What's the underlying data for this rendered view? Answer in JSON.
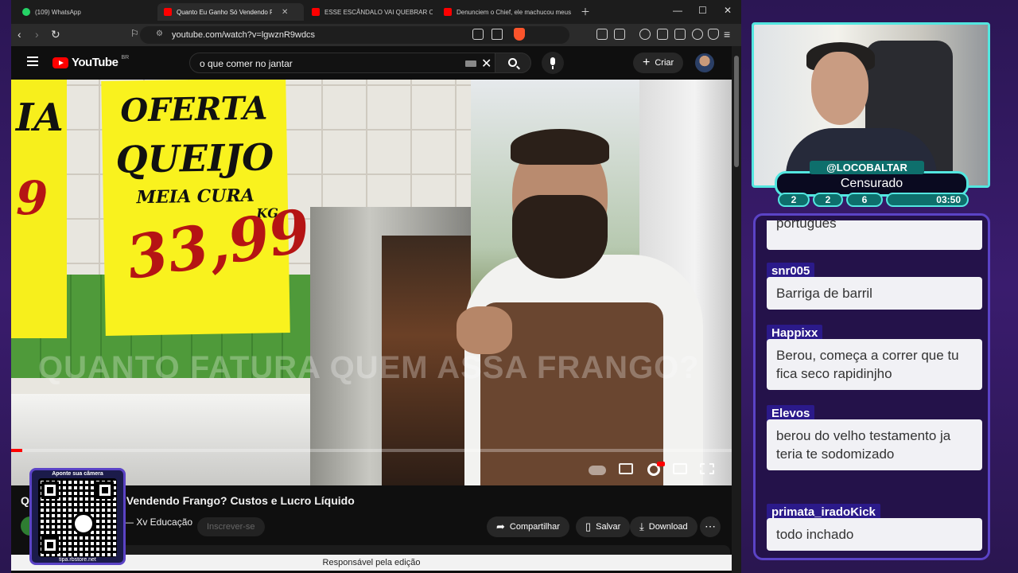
{
  "browser": {
    "tabs": [
      {
        "label": "(109) WhatsApp",
        "icon": "whatsapp-icon"
      },
      {
        "label": "Quanto Eu Ganho Só Vendendo Fra",
        "icon": "youtube-icon",
        "active": true
      },
      {
        "label": "ESSE ESCÂNDALO VAI QUEBRAR O BRASIL E",
        "icon": "youtube-icon"
      },
      {
        "label": "Denunciem o Chief, ele machucou meus sen",
        "icon": "youtube-icon"
      }
    ],
    "url": "youtube.com/watch?v=lgwznR9wdcs"
  },
  "youtube": {
    "logo_text": "YouTube",
    "region": "BR",
    "search_query": "o que comer no jantar",
    "create_label": "Criar",
    "video_overlay_text": "QUANTO FATURA QUEM ASSA FRANGO?",
    "sign_words": {
      "oferta": "OFERTA",
      "queijo": "QUEIJO",
      "meia_cura": "MEIA CURA",
      "kg": "KG",
      "price": "33,99",
      "left_letters": "IA"
    },
    "progress_fraction": 0.016,
    "video_title": "Q... Vendendo Frango? Custos e Lucro Líquido",
    "video_title_visible": "Q",
    "video_title_rest": "Vendendo Frango? Custos e Lucro Líquido",
    "channel": "Xv Educação",
    "subscribe_label": "Inscrever-se",
    "share_label": "Compartilhar",
    "save_label": "Salvar",
    "download_label": "Download",
    "responsavel": "Responsável pela edição"
  },
  "qr": {
    "top": "Aponte sua câmera",
    "bottom": "tipa.rbstore.net"
  },
  "stream": {
    "handle": "@LOCOBALTAR",
    "label": "Censurado",
    "stats": [
      "2",
      "2",
      "6",
      "03:50"
    ]
  },
  "chat": {
    "partial": "português",
    "messages": [
      {
        "user": "snr005",
        "text": "Barriga de barril"
      },
      {
        "user": "Happixx",
        "text": "Berou, começa a correr que tu fica seco rapidinjho"
      },
      {
        "user": "Elevos",
        "text": "berou do velho testamento ja teria te sodomizado"
      },
      {
        "user": "primata_iradoKick",
        "text": "todo inchado"
      }
    ]
  },
  "colors": {
    "accent": "#53e6e0",
    "chat_user_bg": "#2b1a8a",
    "yt_red": "#ff0000"
  }
}
